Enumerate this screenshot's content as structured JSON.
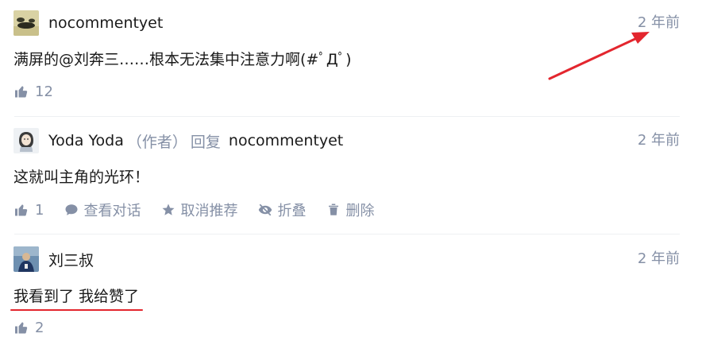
{
  "comments": [
    {
      "author": "nocommentyet",
      "time": "2 年前",
      "content": "满屏的@刘奔三……根本无法集中注意力啊(#ﾟДﾟ)",
      "likes": "12"
    },
    {
      "author": "Yoda Yoda",
      "role": "（作者）",
      "reply_label": "回复",
      "reply_to": "nocommentyet",
      "time": "2 年前",
      "content": "这就叫主角的光环！",
      "likes": "1",
      "actions": {
        "view_conversation": "查看对话",
        "unrecommend": "取消推荐",
        "collapse": "折叠",
        "delete": "删除"
      }
    },
    {
      "author": "刘三叔",
      "time": "2 年前",
      "content": "我看到了 我给赞了",
      "likes": "2"
    }
  ],
  "annotation_colors": {
    "arrow": "#e3262e",
    "underline": "#e3262e"
  },
  "icons": [
    "thumbs-up-icon",
    "speech-bubble-icon",
    "star-icon",
    "eye-slash-icon",
    "trash-icon"
  ]
}
